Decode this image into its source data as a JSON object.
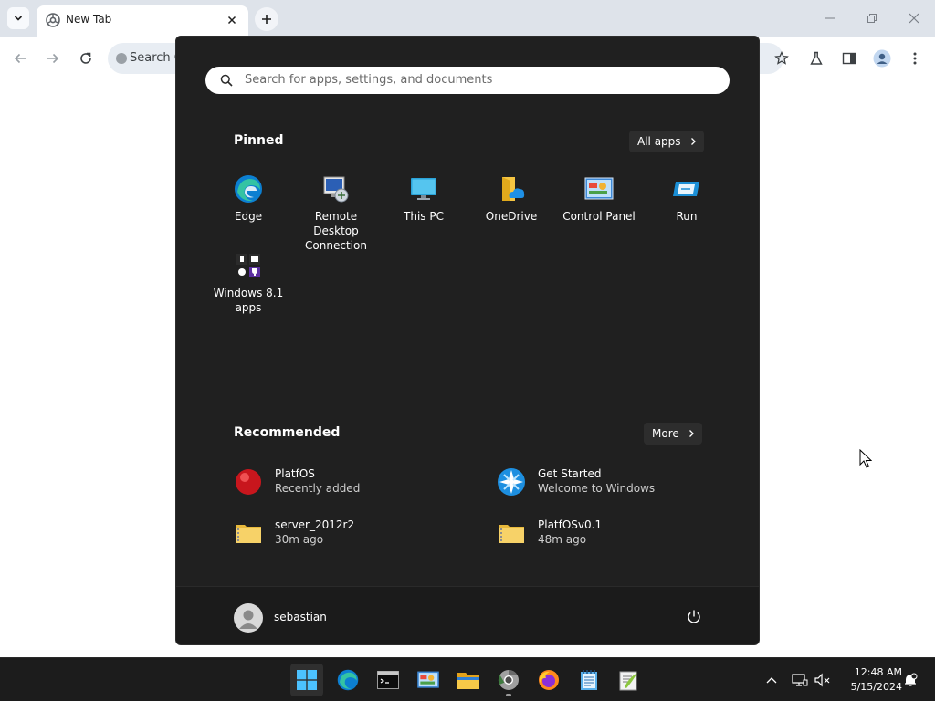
{
  "browser": {
    "tab_title": "New Tab",
    "omnibox_text": "Search G",
    "icons": {
      "tab_list": "chevron-down-icon",
      "close": "close-icon",
      "new_tab": "plus-icon",
      "back": "arrow-left-icon",
      "forward": "arrow-right-icon",
      "reload": "reload-icon",
      "bookmark": "star-icon",
      "labs": "flask-icon",
      "side_panel": "side-panel-icon",
      "profile": "profile-icon",
      "menu": "kebab-menu-icon"
    }
  },
  "start_menu": {
    "search_placeholder": "Search for apps, settings, and documents",
    "pinned_title": "Pinned",
    "all_apps_label": "All apps",
    "pinned": [
      {
        "label": "Edge",
        "icon": "edge-icon"
      },
      {
        "label": "Remote Desktop Connection",
        "icon": "remote-desktop-icon"
      },
      {
        "label": "This PC",
        "icon": "monitor-icon"
      },
      {
        "label": "OneDrive",
        "icon": "onedrive-icon"
      },
      {
        "label": "Control Panel",
        "icon": "control-panel-icon"
      },
      {
        "label": "Run",
        "icon": "run-icon"
      },
      {
        "label": "Windows 8.1 apps",
        "icon": "windows-apps-folder-icon"
      }
    ],
    "recommended_title": "Recommended",
    "more_label": "More",
    "recommended": [
      {
        "name": "PlatfOS",
        "sub": "Recently added",
        "icon": "red-ball-icon"
      },
      {
        "name": "Get Started",
        "sub": "Welcome to Windows",
        "icon": "get-started-icon"
      },
      {
        "name": "server_2012r2",
        "sub": "30m ago",
        "icon": "zip-folder-icon"
      },
      {
        "name": "PlatfOSv0.1",
        "sub": "48m ago",
        "icon": "zip-folder-icon"
      }
    ],
    "user_name": "sebastian"
  },
  "taskbar": {
    "apps": [
      "start-icon",
      "edge-icon",
      "terminal-icon",
      "control-panel-icon",
      "file-explorer-icon",
      "chrome-icon",
      "firefox-icon",
      "notepad-icon",
      "notepad-plus-icon"
    ],
    "time": "12:48 AM",
    "date": "5/15/2024"
  },
  "colors": {
    "start_bg": "#202020",
    "taskbar_bg": "#1c1c1c",
    "tab_strip": "#dee3ea",
    "accent": "#0078d4"
  }
}
